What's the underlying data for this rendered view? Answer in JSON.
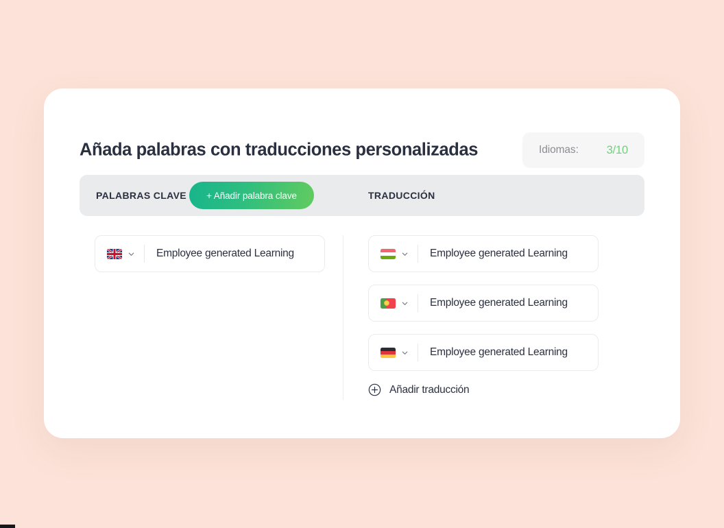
{
  "header": {
    "title": "Añada palabras con traducciones personalizadas",
    "languages_label": "Idiomas:",
    "languages_count": "3/10"
  },
  "tabs": {
    "keywords_label": "PALABRAS CLAVE",
    "add_keyword_label": "+ Añadir palabra clave",
    "translation_label": "TRADUCCIÓN"
  },
  "keywords": [
    {
      "flag": "gb-flag-icon",
      "value": "Employee generated Learning"
    }
  ],
  "translations": [
    {
      "flag": "hu-flag-icon",
      "value": "Employee generated Learning"
    },
    {
      "flag": "pt-flag-icon",
      "value": "Employee generated Learning"
    },
    {
      "flag": "de-flag-icon",
      "value": "Employee generated Learning"
    }
  ],
  "add_translation": {
    "label": "Añadir traducción",
    "icon": "plus-circle-icon"
  },
  "colors": {
    "page_background": "#FCE2D8",
    "card_background": "#FFFFFF",
    "tab_bar_background": "#E9EBEC",
    "accent_green_start": "#17B58C",
    "accent_green_end": "#62CB5F",
    "count_green": "#72CE7F",
    "text_dark": "#2B3040",
    "text_muted": "#8C8C93",
    "border": "#EBEBEB"
  }
}
